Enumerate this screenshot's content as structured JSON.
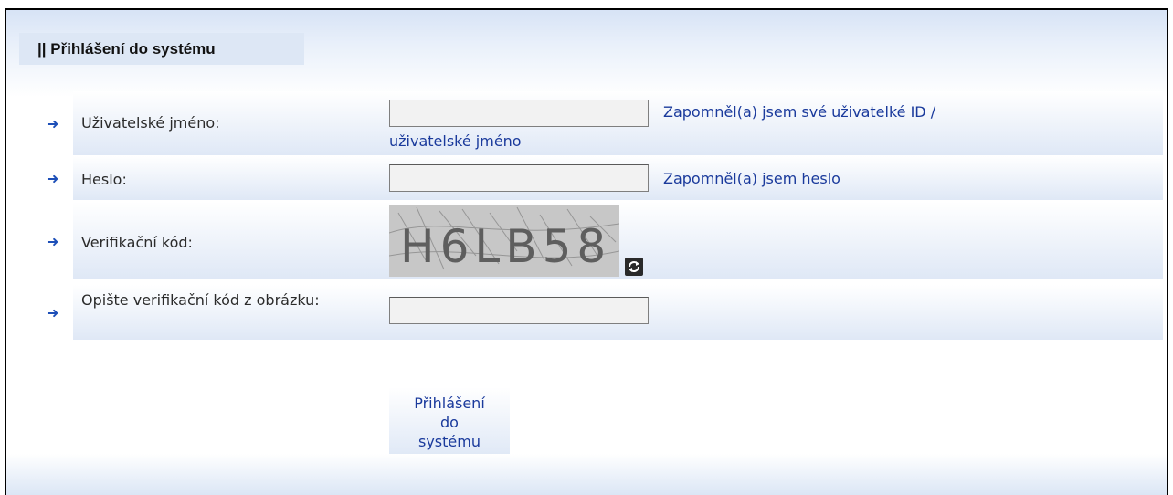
{
  "header": {
    "title": "|| Přihlášení do systému"
  },
  "form": {
    "username": {
      "label": "Uživatelské jméno:",
      "value": "",
      "forgot_link_line1": "Zapomněl(a) jsem své uživatelké ID /",
      "forgot_link_line2": "uživatelské jméno"
    },
    "password": {
      "label": "Heslo:",
      "value": "",
      "forgot_link": "Zapomněl(a) jsem heslo"
    },
    "captcha": {
      "label": "Verifikační kód:",
      "code_text": "H6LB58",
      "refresh_icon": "refresh-icon"
    },
    "captcha_input": {
      "label": "Opište verifikační kód z obrázku:",
      "value": ""
    },
    "submit_label": "Přihlášení\ndo\nsystému"
  },
  "icons": {
    "row_arrow": "arrow-right-icon"
  },
  "colors": {
    "link": "#1a3a9c",
    "arrow": "#1d4fb8",
    "button_underline": "#f1c50f",
    "band": "#dde7f5"
  }
}
